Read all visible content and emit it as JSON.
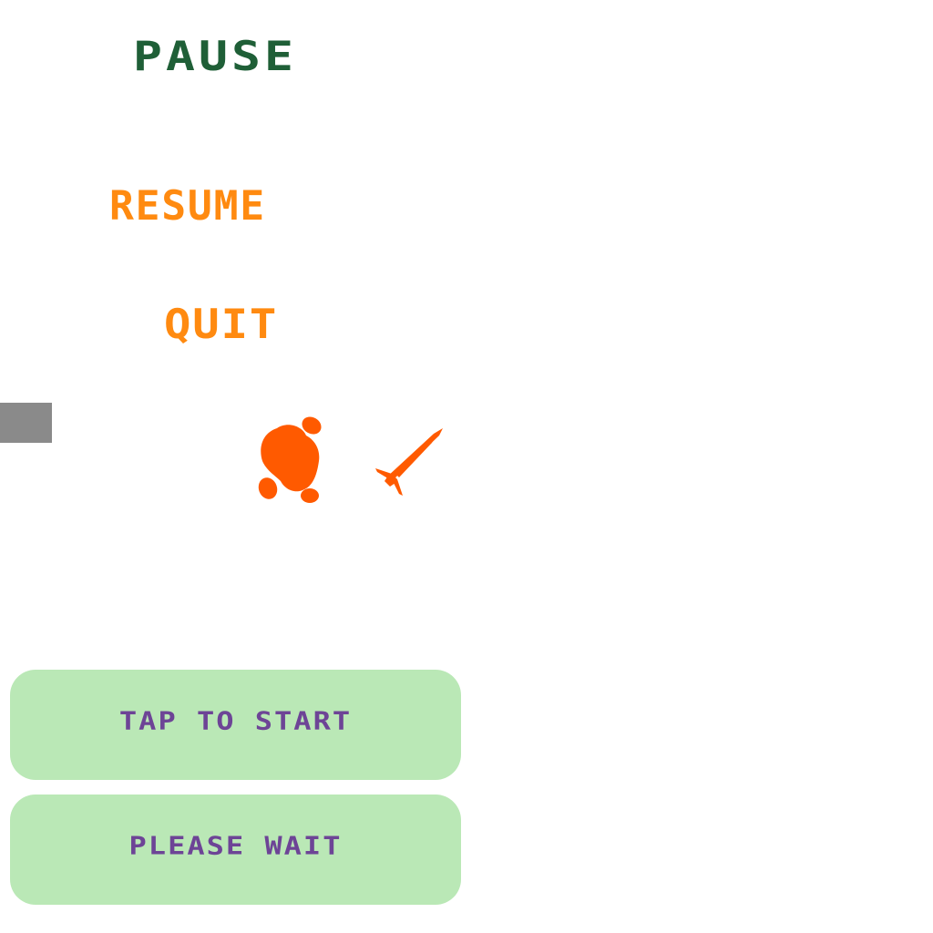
{
  "pause_menu": {
    "title": "PAUSE",
    "resume_label": "RESUME",
    "quit_label": "QUIT"
  },
  "prompts": {
    "start_label": "TAP TO START",
    "wait_label": "PLEASE WAIT"
  },
  "sprites": {
    "blob": "orange-splat-icon",
    "rocket": "rocket-icon"
  },
  "colors": {
    "title": "#1f5f37",
    "menu": "#ff8a10",
    "sprite": "#ff5a00",
    "pill_bg": "#bae8b6",
    "pill_text": "#6d4496",
    "gray_tab": "#8a8a8a",
    "background": "#ffffff"
  }
}
